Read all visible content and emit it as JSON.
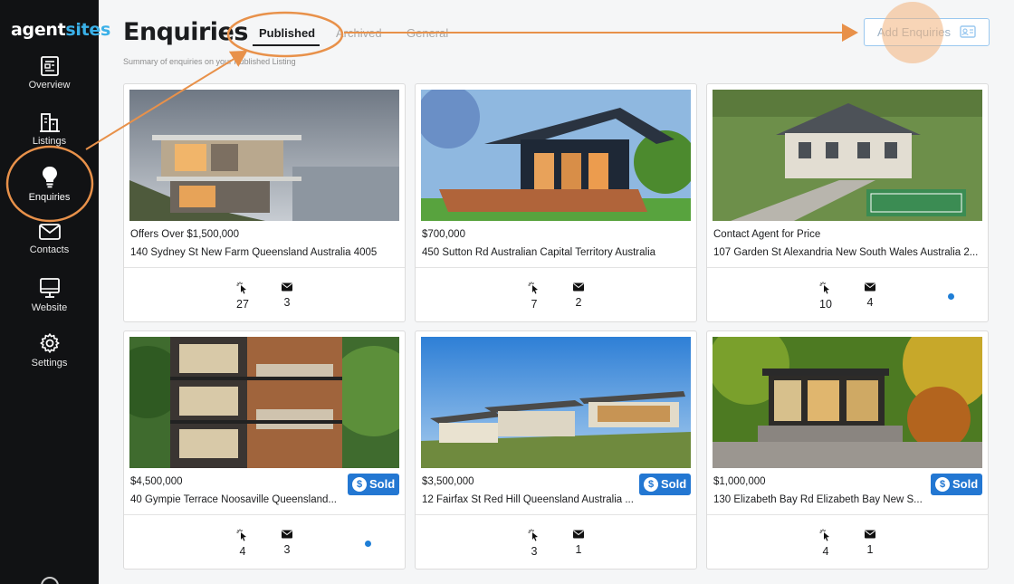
{
  "sidebar": {
    "logo_part1": "agent",
    "logo_part2": "sites",
    "items": [
      {
        "label": "Overview",
        "icon": "document-icon"
      },
      {
        "label": "Listings",
        "icon": "building-icon"
      },
      {
        "label": "Enquiries",
        "icon": "lightbulb-icon"
      },
      {
        "label": "Contacts",
        "icon": "envelope-icon"
      },
      {
        "label": "Website",
        "icon": "monitor-icon"
      },
      {
        "label": "Settings",
        "icon": "gear-icon"
      }
    ]
  },
  "header": {
    "title": "Enquiries",
    "subtitle": "Summary of enquiries on your Published Listing",
    "tabs": [
      "Published",
      "Archived",
      "General"
    ],
    "add_button": "Add Enquiries"
  },
  "colors": {
    "sidebar_bg": "#111214",
    "accent_blue": "#2377d2",
    "logo_blue": "#3ab0e8",
    "annotation_orange": "#e8914a"
  },
  "listings": [
    {
      "price": "Offers Over $1,500,000",
      "address": "140 Sydney St New Farm Queensland Australia 4005",
      "views": "27",
      "enquiries": "3",
      "sold": false,
      "dot": false
    },
    {
      "price": "$700,000",
      "address": "450 Sutton Rd Australian Capital Territory Australia",
      "views": "7",
      "enquiries": "2",
      "sold": false,
      "dot": false
    },
    {
      "price": "Contact Agent for Price",
      "address": "107 Garden St Alexandria New South Wales Australia 2...",
      "views": "10",
      "enquiries": "4",
      "sold": false,
      "dot": true
    },
    {
      "price": "$4,500,000",
      "address": "40 Gympie Terrace Noosaville Queensland...",
      "views": "4",
      "enquiries": "3",
      "sold": true,
      "dot": true
    },
    {
      "price": "$3,500,000",
      "address": "12 Fairfax St Red Hill Queensland Australia ...",
      "views": "3",
      "enquiries": "1",
      "sold": true,
      "dot": false
    },
    {
      "price": "$1,000,000",
      "address": "130 Elizabeth Bay Rd Elizabeth Bay New S...",
      "views": "4",
      "enquiries": "1",
      "sold": true,
      "dot": false
    }
  ],
  "sold_label": "Sold",
  "sold_icon": "$"
}
